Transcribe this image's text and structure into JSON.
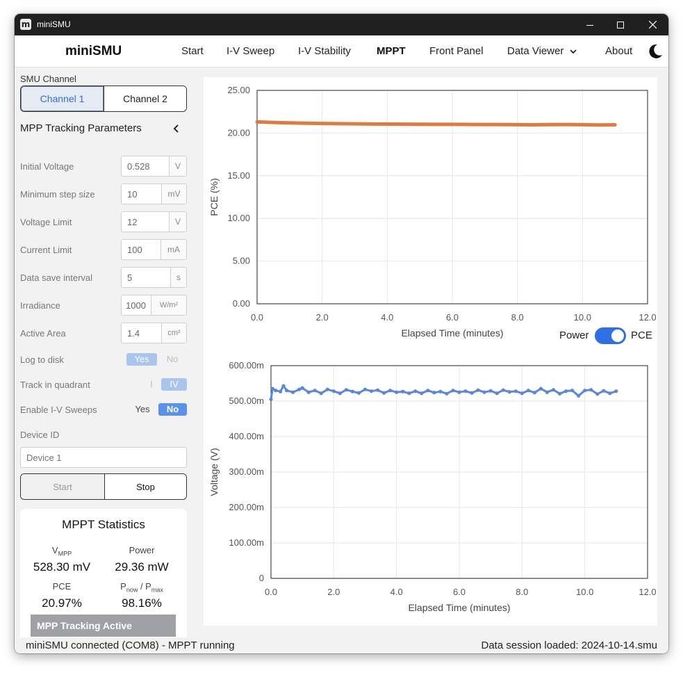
{
  "window": {
    "title": "miniSMU"
  },
  "nav": {
    "brand": "miniSMU",
    "items": [
      "Start",
      "I-V Sweep",
      "I-V Stability",
      "MPPT",
      "Front Panel",
      "Data Viewer",
      "About"
    ],
    "active": "MPPT"
  },
  "sidebar": {
    "channel_label": "SMU Channel",
    "channel1": "Channel 1",
    "channel2": "Channel 2",
    "params_title": "MPP Tracking Parameters",
    "params": [
      {
        "label": "Initial Voltage",
        "value": "0.528",
        "unit": "V"
      },
      {
        "label": "Minimum step size",
        "value": "10",
        "unit": "mV"
      },
      {
        "label": "Voltage Limit",
        "value": "12",
        "unit": "V"
      },
      {
        "label": "Current Limit",
        "value": "100",
        "unit": "mA"
      },
      {
        "label": "Data save interval",
        "value": "5",
        "unit": "s"
      },
      {
        "label": "Irradiance",
        "value": "1000",
        "unit": "W/m²"
      },
      {
        "label": "Active Area",
        "value": "1.4",
        "unit": "cm²"
      }
    ],
    "log_to_disk": {
      "label": "Log to disk",
      "yes": "Yes",
      "no": "No"
    },
    "quadrant": {
      "label": "Track in quadrant",
      "opt1": "I",
      "opt2": "IV"
    },
    "iv_sweeps": {
      "label": "Enable I-V Sweeps",
      "yes": "Yes",
      "no": "No"
    },
    "device_id": {
      "label": "Device ID",
      "placeholder": "Device 1"
    },
    "start": "Start",
    "stop": "Stop"
  },
  "stats": {
    "title": "MPPT Statistics",
    "vmpp_label": "V",
    "vmpp_sub": "MPP",
    "vmpp_value": "528.30 mV",
    "power_label": "Power",
    "power_value": "29.36 mW",
    "pce_label": "PCE",
    "pce_value": "20.97%",
    "ratio_p1": "P",
    "ratio_sub1": "now",
    "ratio_slash": " / P",
    "ratio_sub2": "max",
    "ratio_value": "98.16%",
    "banner": "MPP Tracking Active"
  },
  "toggle": {
    "left": "Power",
    "right": "PCE"
  },
  "status": {
    "left": "miniSMU connected (COM8) - MPPT running",
    "right": "Data session loaded: 2024-10-14.smu"
  },
  "colors": {
    "pce": "#e07b3f",
    "voltage": "#5a86de",
    "accent": "#2f6fe4"
  },
  "chart_data": [
    {
      "type": "line",
      "xlabel": "Elapsed Time (minutes)",
      "ylabel": "PCE (%)",
      "xlim": [
        0,
        12
      ],
      "ylim": [
        0,
        25
      ],
      "xticks": [
        "0.0",
        "2.0",
        "4.0",
        "6.0",
        "8.0",
        "10.0",
        "12.0"
      ],
      "yticks": [
        "0.00",
        "5.00",
        "10.00",
        "15.00",
        "20.00",
        "25.00"
      ],
      "grid": true,
      "series": [
        {
          "x": [
            0.0,
            0.5,
            1.0,
            1.5,
            2.0,
            2.5,
            3.0,
            3.5,
            4.0,
            4.5,
            5.0,
            5.5,
            6.0,
            6.5,
            7.0,
            7.5,
            8.0,
            8.5,
            9.0,
            9.5,
            10.0,
            10.5,
            11.0
          ],
          "y": [
            21.3,
            21.25,
            21.2,
            21.15,
            21.12,
            21.1,
            21.08,
            21.06,
            21.05,
            21.04,
            21.03,
            21.02,
            21.02,
            21.01,
            21.0,
            21.0,
            20.98,
            20.97,
            20.99,
            21.0,
            20.98,
            20.95,
            20.97
          ]
        }
      ]
    },
    {
      "type": "line",
      "xlabel": "Elapsed Time (minutes)",
      "ylabel": "Voltage (V)",
      "xlim": [
        0,
        12
      ],
      "ylim": [
        0,
        0.6
      ],
      "xticks": [
        "0.0",
        "2.0",
        "4.0",
        "6.0",
        "8.0",
        "10.0",
        "12.0"
      ],
      "yticks": [
        "0",
        "100.00m",
        "200.00m",
        "300.00m",
        "400.00m",
        "500.00m",
        "600.00m"
      ],
      "grid": true,
      "series": [
        {
          "x": [
            0.0,
            0.05,
            0.15,
            0.3,
            0.4,
            0.5,
            0.7,
            0.9,
            1.0,
            1.2,
            1.4,
            1.6,
            1.8,
            2.0,
            2.2,
            2.4,
            2.6,
            2.8,
            3.0,
            3.2,
            3.4,
            3.6,
            3.8,
            4.0,
            4.2,
            4.4,
            4.6,
            4.8,
            5.0,
            5.2,
            5.4,
            5.6,
            5.8,
            6.0,
            6.2,
            6.4,
            6.6,
            6.8,
            7.0,
            7.2,
            7.4,
            7.6,
            7.8,
            8.0,
            8.2,
            8.4,
            8.6,
            8.8,
            9.0,
            9.2,
            9.4,
            9.6,
            9.8,
            10.0,
            10.2,
            10.4,
            10.6,
            10.8,
            11.0
          ],
          "y": [
            0.505,
            0.535,
            0.53,
            0.527,
            0.543,
            0.53,
            0.525,
            0.533,
            0.537,
            0.525,
            0.53,
            0.522,
            0.533,
            0.528,
            0.522,
            0.532,
            0.527,
            0.523,
            0.533,
            0.528,
            0.531,
            0.523,
            0.53,
            0.525,
            0.527,
            0.522,
            0.528,
            0.522,
            0.53,
            0.524,
            0.527,
            0.521,
            0.53,
            0.525,
            0.528,
            0.523,
            0.531,
            0.525,
            0.529,
            0.522,
            0.531,
            0.526,
            0.528,
            0.522,
            0.53,
            0.524,
            0.535,
            0.525,
            0.532,
            0.521,
            0.528,
            0.53,
            0.515,
            0.53,
            0.532,
            0.52,
            0.529,
            0.522,
            0.528
          ]
        }
      ]
    }
  ]
}
